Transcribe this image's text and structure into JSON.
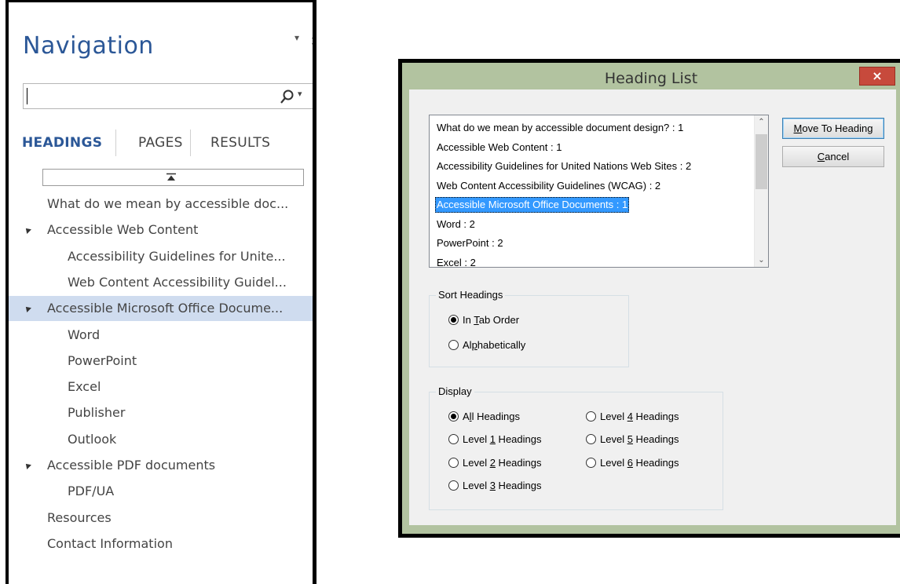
{
  "navigation": {
    "title": "Navigation",
    "menu_glyph": "▾",
    "close_glyph": "✕",
    "search": {
      "value": "",
      "icon": "search-icon"
    },
    "tabs": [
      "HEADINGS",
      "PAGES",
      "RESULTS"
    ],
    "active_tab": "HEADINGS",
    "headings": [
      {
        "label": "What do we mean by accessible doc...",
        "level": 1,
        "expandable": false
      },
      {
        "label": "Accessible Web Content",
        "level": 1,
        "expandable": true
      },
      {
        "label": "Accessibility Guidelines for Unite...",
        "level": 2,
        "expandable": false
      },
      {
        "label": "Web Content Accessibility Guidel...",
        "level": 2,
        "expandable": false
      },
      {
        "label": "Accessible Microsoft Office Docume...",
        "level": 1,
        "expandable": true,
        "selected": true
      },
      {
        "label": "Word",
        "level": 2,
        "expandable": false
      },
      {
        "label": "PowerPoint",
        "level": 2,
        "expandable": false
      },
      {
        "label": "Excel",
        "level": 2,
        "expandable": false
      },
      {
        "label": "Publisher",
        "level": 2,
        "expandable": false
      },
      {
        "label": "Outlook",
        "level": 2,
        "expandable": false
      },
      {
        "label": "Accessible PDF documents",
        "level": 1,
        "expandable": true
      },
      {
        "label": "PDF/UA",
        "level": 2,
        "expandable": false
      },
      {
        "label": "Resources",
        "level": 1,
        "expandable": false
      },
      {
        "label": "Contact Information",
        "level": 1,
        "expandable": false
      }
    ]
  },
  "dialog": {
    "title": "Heading List",
    "close_label": "×",
    "list_items": [
      "What do we mean by accessible document design? : 1",
      "Accessible Web Content : 1",
      "Accessibility Guidelines for United Nations Web Sites : 2",
      "Web Content Accessibility Guidelines (WCAG) : 2",
      "Accessible Microsoft Office Documents : 1",
      "Word : 2",
      "PowerPoint : 2",
      "Excel : 2"
    ],
    "selected_item": "Accessible Microsoft Office Documents : 1",
    "buttons": {
      "move": "Move To Heading",
      "cancel": "Cancel"
    },
    "sort": {
      "label": "Sort Headings",
      "options": [
        {
          "pre": "In ",
          "key": "T",
          "post": "ab Order",
          "checked": true
        },
        {
          "pre": "Al",
          "key": "p",
          "post": "habetically",
          "checked": false
        }
      ]
    },
    "display": {
      "label": "Display",
      "options": [
        {
          "pre": "A",
          "key": "l",
          "post": "l Headings",
          "checked": true
        },
        {
          "pre": "Level ",
          "key": "1",
          "post": " Headings",
          "checked": false
        },
        {
          "pre": "Level ",
          "key": "2",
          "post": " Headings",
          "checked": false
        },
        {
          "pre": "Level ",
          "key": "3",
          "post": " Headings",
          "checked": false
        },
        {
          "pre": "Level ",
          "key": "4",
          "post": " Headings",
          "checked": false
        },
        {
          "pre": "Level ",
          "key": "5",
          "post": " Headings",
          "checked": false
        },
        {
          "pre": "Level ",
          "key": "6",
          "post": " Headings",
          "checked": false
        }
      ]
    }
  },
  "colors": {
    "nav_title": "#2b5797",
    "nav_selected": "#cfdcef",
    "dialog_frame": "#b2c3a0",
    "list_selected": "#3399ff",
    "close_button": "#c74a3c"
  }
}
